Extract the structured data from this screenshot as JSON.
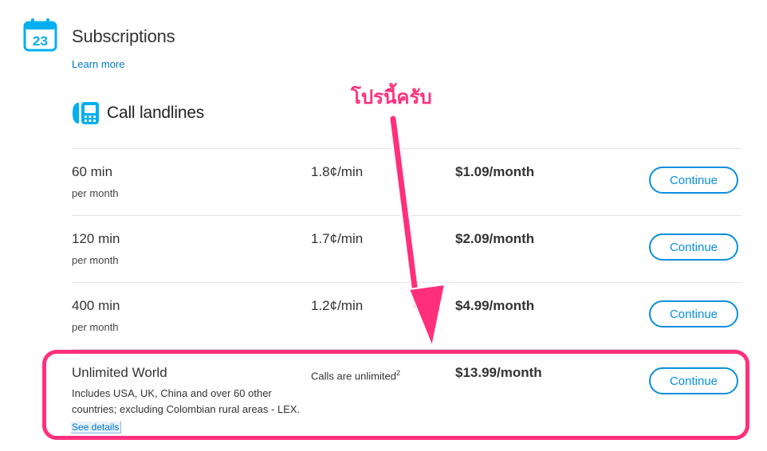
{
  "header": {
    "icon_day": "23",
    "title": "Subscriptions",
    "learn_more": "Learn more"
  },
  "section": {
    "title": "Call landlines"
  },
  "plans": [
    {
      "name": "60 min",
      "sub": "per month",
      "rate": "1.8¢/min",
      "price": "$1.09/month",
      "button": "Continue"
    },
    {
      "name": "120 min",
      "sub": "per month",
      "rate": "1.7¢/min",
      "price": "$2.09/month",
      "button": "Continue"
    },
    {
      "name": "400 min",
      "sub": "per month",
      "rate": "1.2¢/min",
      "price": "$4.99/month",
      "button": "Continue"
    },
    {
      "name": "Unlimited World",
      "rate": "Calls are unlimited",
      "rate_sup": "2",
      "price": "$13.99/month",
      "button": "Continue",
      "desc": "Includes USA, UK, China and over 60 other countries; excluding Colombian rural areas - LEX.",
      "details": "See details"
    }
  ],
  "annotation": {
    "text": "โปรนี้ครับ",
    "color": "#ff2f7c"
  },
  "colors": {
    "accent": "#0a8fde",
    "link": "#0078ca",
    "highlight": "#ff2f7c"
  }
}
